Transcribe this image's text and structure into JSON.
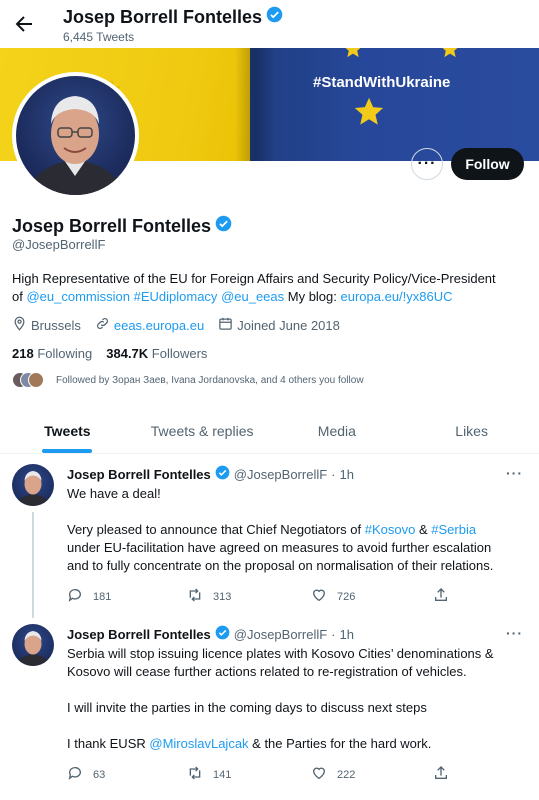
{
  "header": {
    "title": "Josep Borrell Fontelles",
    "tweet_count": "6,445 Tweets"
  },
  "banner": {
    "tag": "#StandWithUkraine"
  },
  "profile": {
    "name": "Josep Borrell Fontelles",
    "handle": "@JosepBorrellF",
    "bio_line1": "High Representative of the EU for Foreign Affairs and Security Policy/Vice-President",
    "bio_of": "of ",
    "bio_link1": "@eu_commission",
    "bio_link2": "#EUdiplomacy",
    "bio_link3": "@eu_eeas",
    "bio_blog": " My blog: ",
    "bio_link4": "europa.eu/!yx86UC",
    "location": "Brussels",
    "website": "eeas.europa.eu",
    "joined": "Joined June 2018",
    "following_count": "218",
    "following_label": "Following",
    "followers_count": "384.7K",
    "followers_label": "Followers",
    "followed_by": "Followed by Зоран Заев, Ivana Jordanovska, and 4 others you follow",
    "follow_button": "Follow",
    "more_button": "···"
  },
  "tabs": [
    {
      "label": "Tweets",
      "active": true
    },
    {
      "label": "Tweets & replies"
    },
    {
      "label": "Media"
    },
    {
      "label": "Likes"
    }
  ],
  "tweets": [
    {
      "name": "Josep Borrell Fontelles",
      "handle": "@JosepBorrellF",
      "sep": "·",
      "time": "1h",
      "line1": "We have a deal!",
      "line2a": "Very pleased to announce that Chief Negotiators of ",
      "tag1": "#Kosovo",
      "amp": " & ",
      "tag2": "#Serbia",
      "line3": "under EU-facilitation have agreed on measures to avoid further escalation",
      "line4": "and to fully concentrate on the proposal on normalisation of their relations.",
      "replies": "181",
      "retweets": "313",
      "likes": "726"
    },
    {
      "name": "Josep Borrell Fontelles",
      "handle": "@JosepBorrellF",
      "sep": "·",
      "time": "1h",
      "line1": "Serbia will stop issuing licence plates with Kosovo Cities’ denominations &",
      "line2": "Kosovo will cease further actions related to re-registration of vehicles.",
      "line3": "I will invite the parties in the coming days to discuss next steps",
      "line4a": "I thank EUSR ",
      "mention": "@MiroslavLajcak",
      "line4b": " & the Parties for the hard work.",
      "replies": "63",
      "retweets": "141",
      "likes": "222"
    }
  ],
  "colors": {
    "accent": "#1d9bf0",
    "text": "#0f1419",
    "secondary": "#536471",
    "banner_yellow": "#f4d31b",
    "banner_blue": "#27479a"
  }
}
